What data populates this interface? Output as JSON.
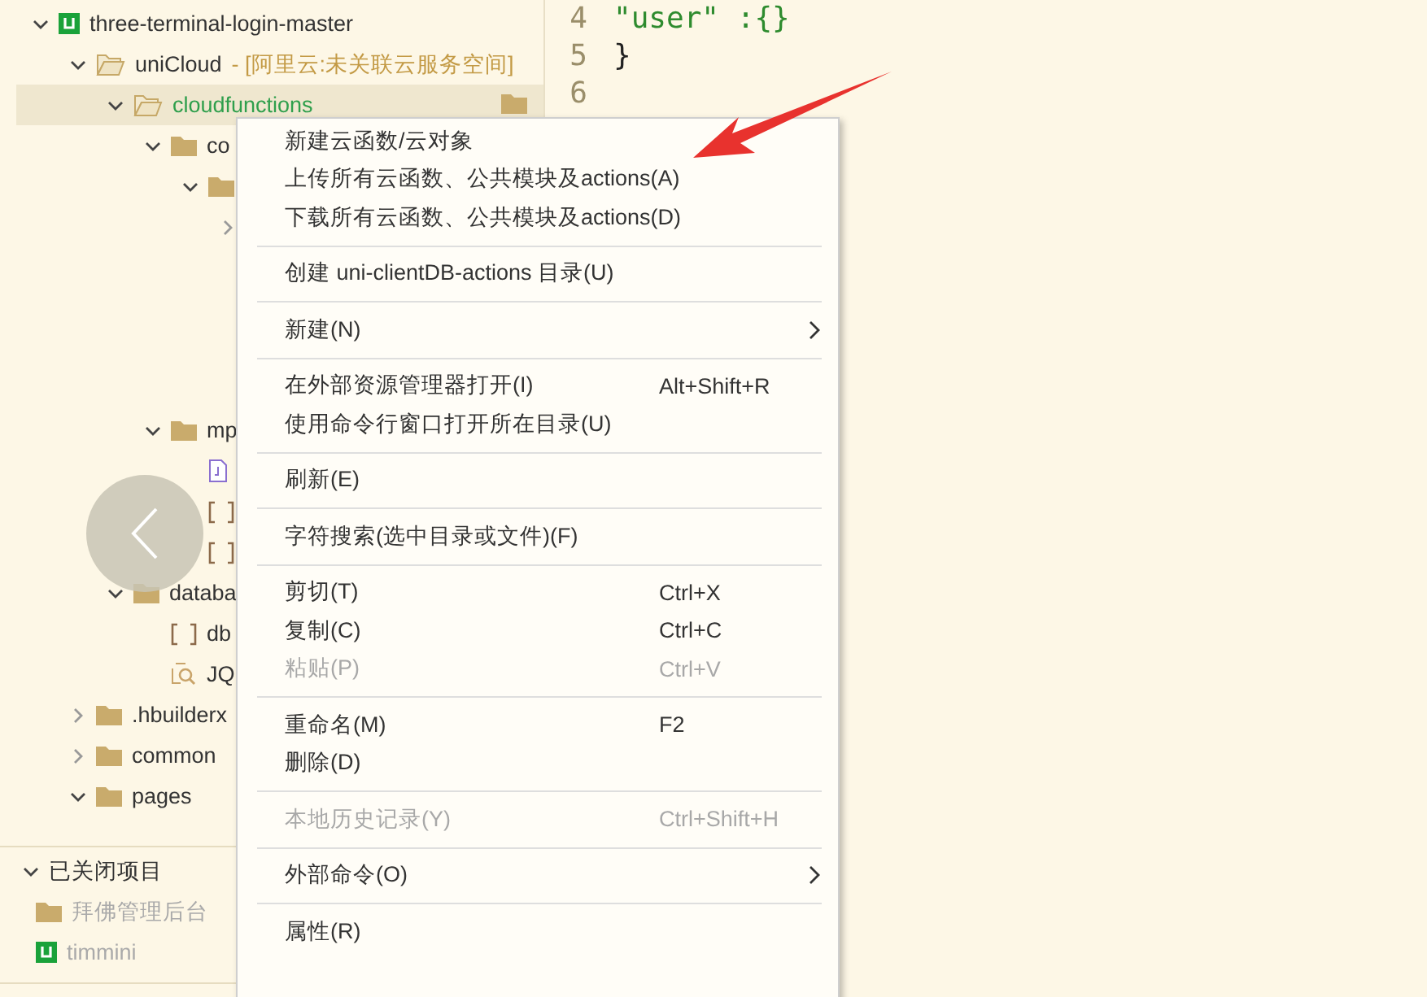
{
  "tree": [
    {
      "name": "three-terminal-login-master",
      "kind": "project",
      "expanded": true,
      "selected": false,
      "children": [
        {
          "name": "uniCloud",
          "note": "- [阿里云:未关联云服务空间]",
          "kind": "open-folder",
          "expanded": true,
          "selected": false,
          "children": [
            {
              "name": "cloudfunctions",
              "kind": "open-folder",
              "expanded": true,
              "selected": true,
              "children": [
                {
                  "name": "co",
                  "kind": "folder",
                  "expanded": true,
                  "selected": false,
                  "children": [
                    {
                      "kind": "folder",
                      "expanded": true,
                      "selected": false,
                      "children": [
                        {
                          "expanded": false,
                          "selected": false
                        }
                      ]
                    }
                  ]
                },
                {
                  "name": "mp",
                  "kind": "folder",
                  "expanded": true,
                  "selected": false,
                  "children": [
                    {
                      "kind": "file",
                      "selected": false
                    },
                    {
                      "kind": "json",
                      "selected": false
                    },
                    {
                      "kind": "json",
                      "selected": false
                    }
                  ]
                }
              ]
            },
            {
              "name": "databa",
              "kind": "folder",
              "expanded": true,
              "selected": false,
              "children": [
                {
                  "name": "db",
                  "kind": "json",
                  "selected": false
                },
                {
                  "name": "JQ",
                  "kind": "query",
                  "selected": false
                }
              ]
            }
          ]
        },
        {
          "name": ".hbuilderx",
          "kind": "folder",
          "expanded": false,
          "selected": false
        },
        {
          "name": "common",
          "kind": "folder",
          "expanded": false,
          "selected": false
        },
        {
          "name": "pages",
          "kind": "folder",
          "expanded": true,
          "selected": false
        }
      ]
    }
  ],
  "closed_projects": {
    "title": "已关闭项目",
    "expanded": true,
    "items": [
      {
        "name": "拜佛管理后台",
        "kind": "folder"
      },
      {
        "name": "timmini",
        "kind": "project"
      }
    ]
  },
  "editor": {
    "lines": [
      {
        "number": "4",
        "code": "\"user\" :{}"
      },
      {
        "number": "5",
        "code": "}"
      },
      {
        "number": "6"
      }
    ]
  },
  "context_menu": [
    {
      "kind": "item",
      "label": "新建云函数/云对象",
      "disabled": false,
      "submenu": false
    },
    {
      "kind": "item",
      "label": "上传所有云函数、公共模块及actions(A)",
      "disabled": false,
      "submenu": false
    },
    {
      "kind": "item",
      "label": "下载所有云函数、公共模块及actions(D)",
      "disabled": false,
      "submenu": false
    },
    {
      "kind": "separator"
    },
    {
      "kind": "item",
      "label": "创建 uni-clientDB-actions 目录(U)",
      "disabled": false,
      "submenu": false
    },
    {
      "kind": "separator"
    },
    {
      "kind": "item",
      "label": "新建(N)",
      "disabled": false,
      "submenu": true
    },
    {
      "kind": "separator"
    },
    {
      "kind": "item",
      "label": "在外部资源管理器打开(I)",
      "shortcut": "Alt+Shift+R",
      "disabled": false,
      "submenu": false
    },
    {
      "kind": "item",
      "label": "使用命令行窗口打开所在目录(U)",
      "disabled": false,
      "submenu": false
    },
    {
      "kind": "separator"
    },
    {
      "kind": "item",
      "label": "刷新(E)",
      "disabled": false,
      "submenu": false
    },
    {
      "kind": "separator"
    },
    {
      "kind": "item",
      "label": "字符搜索(选中目录或文件)(F)",
      "disabled": false,
      "submenu": false
    },
    {
      "kind": "separator"
    },
    {
      "kind": "item",
      "label": "剪切(T)",
      "shortcut": "Ctrl+X",
      "disabled": false,
      "submenu": false
    },
    {
      "kind": "item",
      "label": "复制(C)",
      "shortcut": "Ctrl+C",
      "disabled": false,
      "submenu": false
    },
    {
      "kind": "item",
      "label": "粘贴(P)",
      "shortcut": "Ctrl+V",
      "disabled": true,
      "submenu": false
    },
    {
      "kind": "separator"
    },
    {
      "kind": "item",
      "label": "重命名(M)",
      "shortcut": "F2",
      "disabled": false,
      "submenu": false
    },
    {
      "kind": "item",
      "label": "删除(D)",
      "disabled": false,
      "submenu": false
    },
    {
      "kind": "separator"
    },
    {
      "kind": "item",
      "label": "本地历史记录(Y)",
      "shortcut": "Ctrl+Shift+H",
      "disabled": true,
      "submenu": false
    },
    {
      "kind": "separator"
    },
    {
      "kind": "item",
      "label": "外部命令(O)",
      "disabled": false,
      "submenu": true
    },
    {
      "kind": "separator"
    },
    {
      "kind": "item",
      "label": "属性(R)",
      "disabled": false,
      "submenu": false
    }
  ]
}
